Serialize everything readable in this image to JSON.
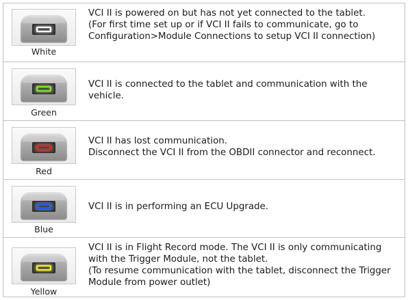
{
  "rows": [
    {
      "caption": "White",
      "led_color": "#ffffff",
      "led_glow": "#f0f0f0",
      "lines": [
        "VCI II is powered on but has not yet connected to the tablet.",
        "(For first time set up or if VCI II fails to communicate, go to",
        "Configuration>Module Connections to setup VCI II connection)"
      ]
    },
    {
      "caption": "Green",
      "led_color": "#7ee320",
      "led_glow": "#c7f07c",
      "lines": [
        "VCI II is connected to the tablet and communication with the",
        "vehicle."
      ]
    },
    {
      "caption": "Red",
      "led_color": "#f01a10",
      "led_glow": "#ff7a6a",
      "lines": [
        "VCI II has lost communication.",
        "Disconnect the VCI II from the OBDII connector and reconnect."
      ]
    },
    {
      "caption": "Blue",
      "led_color": "#1e5be8",
      "led_glow": "#7fa8ff",
      "lines": [
        "VCI II is in performing an ECU Upgrade."
      ]
    },
    {
      "caption": "Yellow",
      "led_color": "#f2f20a",
      "led_glow": "#ffff8a",
      "lines": [
        "VCI II is in Flight Record mode. The VCI II is only communicating",
        "with the Trigger Module, not the tablet.",
        "(To resume communication with the tablet, disconnect the Trigger",
        "Module from power outlet)"
      ]
    }
  ]
}
